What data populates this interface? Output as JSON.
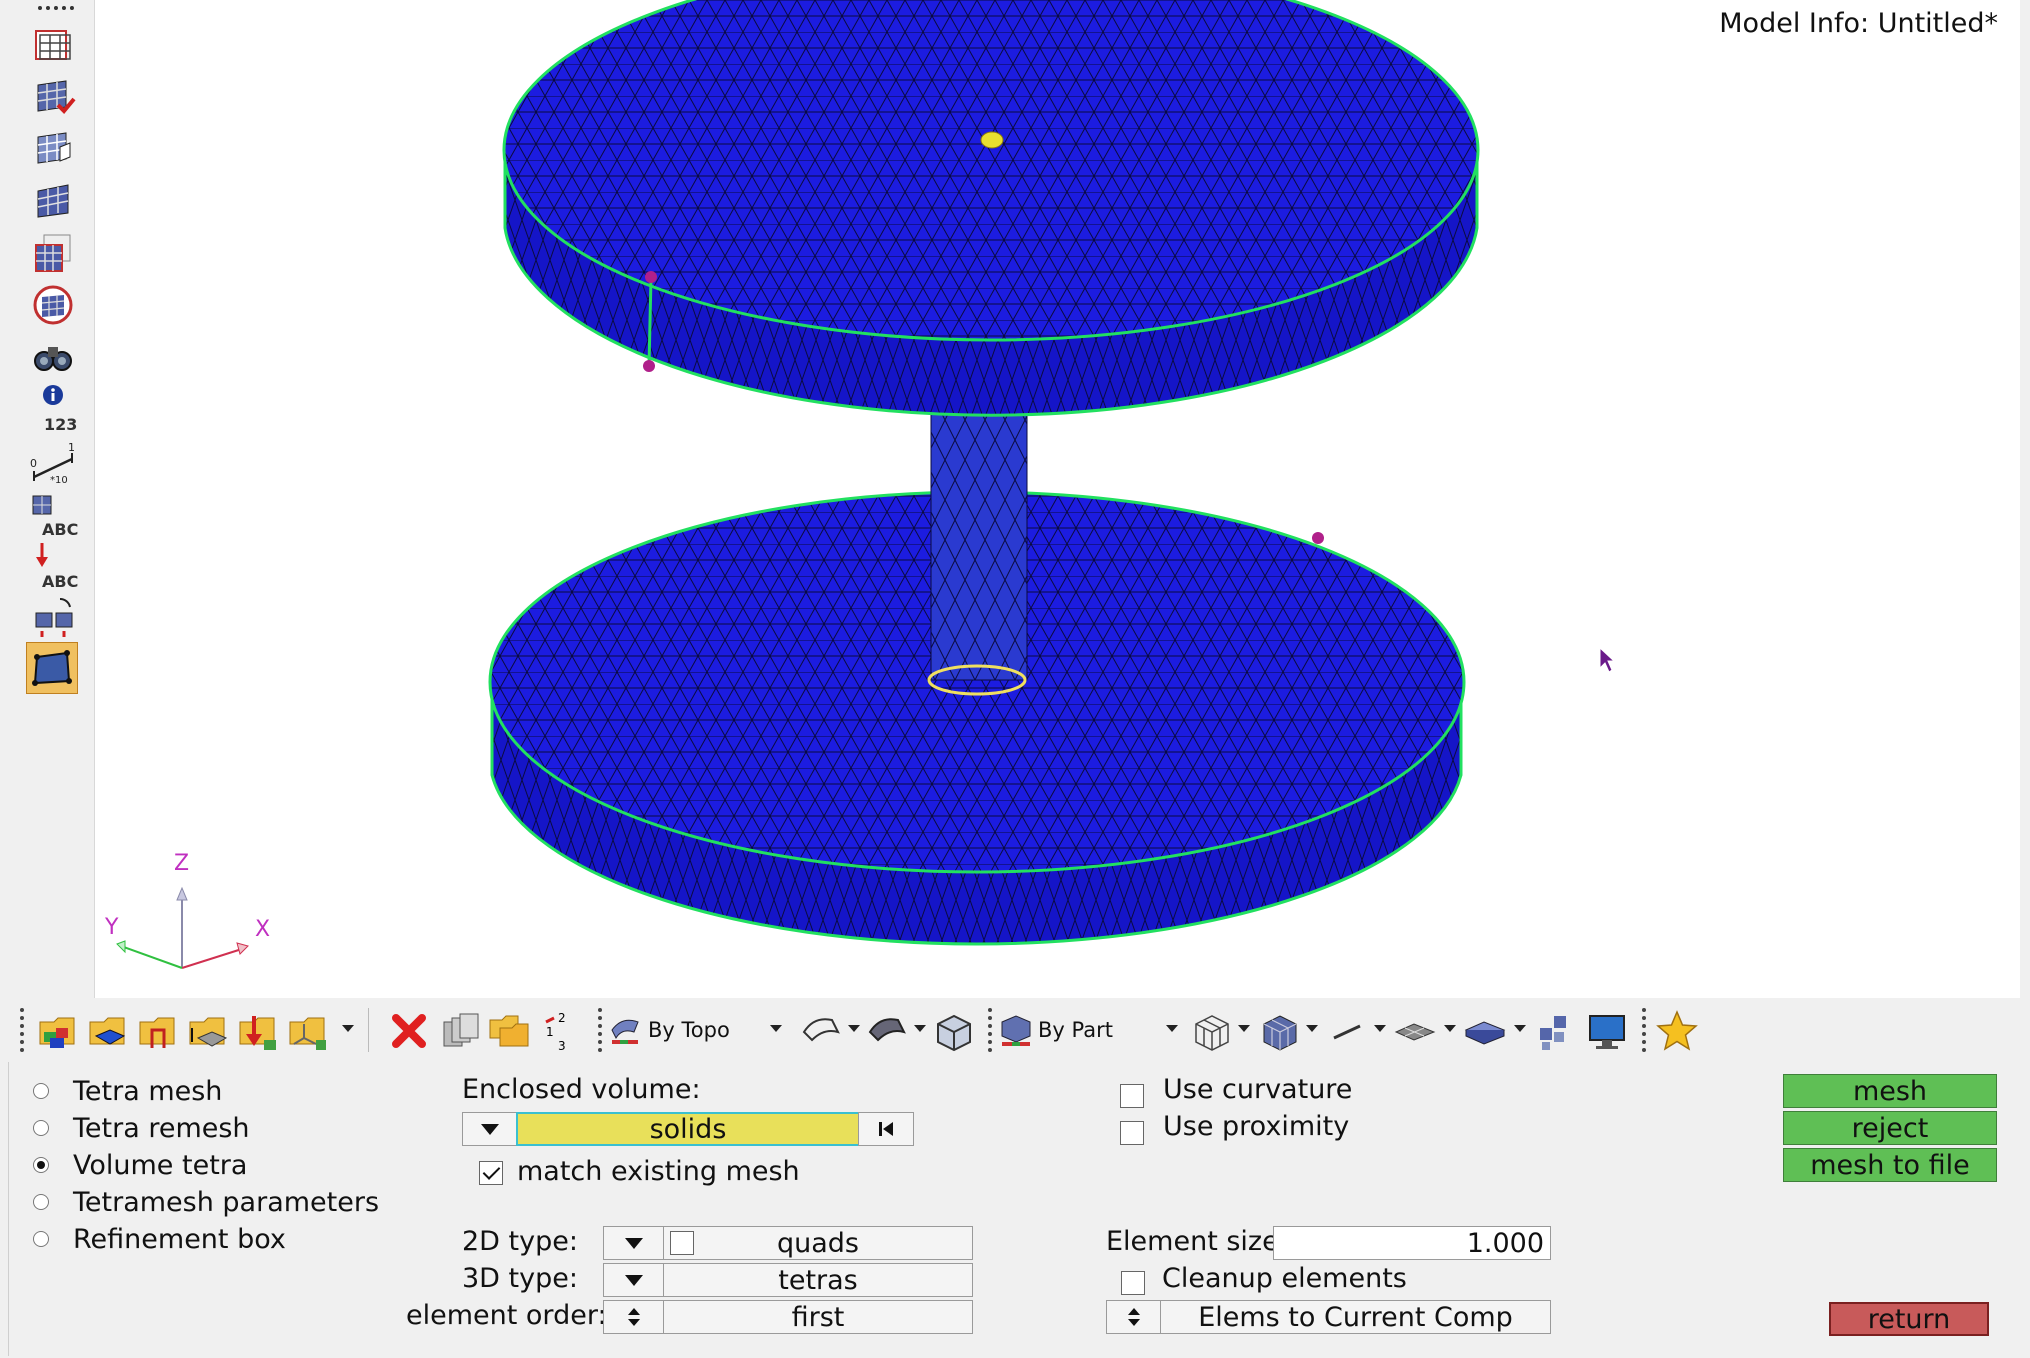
{
  "viewport": {
    "model_info": "Model Info: Untitled*",
    "triad": {
      "z": "Z",
      "y": "Y",
      "x": "X"
    }
  },
  "left_toolbar": {
    "count_label": "123",
    "scale_top": "1",
    "scale_left": "0",
    "scale_small": "*10",
    "abc_1": "ABC",
    "abc_2": "ABC"
  },
  "bottom_toolbar": {
    "by_topo": "By Topo",
    "by_part": "By Part"
  },
  "panel": {
    "modes": [
      {
        "label": "Tetra mesh",
        "selected": false
      },
      {
        "label": "Tetra remesh",
        "selected": false
      },
      {
        "label": "Volume tetra",
        "selected": true
      },
      {
        "label": "Tetramesh parameters",
        "selected": false
      },
      {
        "label": "Refinement box",
        "selected": false
      }
    ],
    "enclosed_volume_label": "Enclosed volume:",
    "enclosed_volume_value": "solids",
    "match_existing_mesh": "match existing mesh",
    "type_2d_label": "2D type:",
    "type_2d_value": "quads",
    "type_3d_label": "3D type:",
    "type_3d_value": "tetras",
    "element_order_label": "element order:",
    "element_order_value": "first",
    "use_curvature": "Use curvature",
    "use_proximity": "Use proximity",
    "element_size_label": "Element size:",
    "element_size_value": "1.000",
    "cleanup_elements": "Cleanup elements",
    "elems_dest": "Elems to Current Comp",
    "mesh_btn": "mesh",
    "reject_btn": "reject",
    "mesh_to_file_btn": "mesh to file",
    "return_btn": "return"
  },
  "colors": {
    "mesh_blue": "#1a1ae0",
    "edge_green": "#22e060",
    "action_green": "#5fbf55",
    "return_red": "#c85a5a",
    "selection_yellow": "#e8e05a"
  }
}
